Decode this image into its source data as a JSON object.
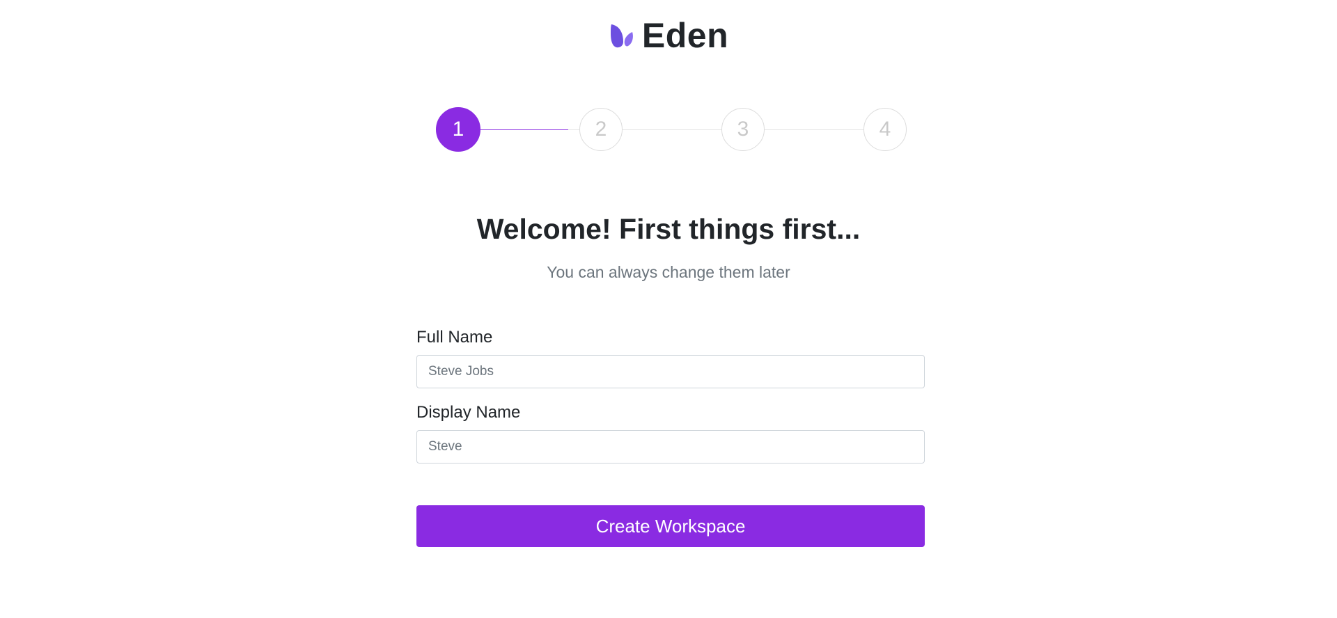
{
  "brand": {
    "name": "Eden",
    "logo_icon": "leaf-logo-icon",
    "logo_color": "#6c4fe0"
  },
  "stepper": {
    "steps": [
      "1",
      "2",
      "3",
      "4"
    ],
    "current_step": 1,
    "active_color": "#8a2be2"
  },
  "main": {
    "title": "Welcome! First things first...",
    "subtitle": "You can always change them later"
  },
  "form": {
    "full_name": {
      "label": "Full Name",
      "placeholder": "Steve Jobs",
      "value": ""
    },
    "display_name": {
      "label": "Display Name",
      "placeholder": "Steve",
      "value": ""
    },
    "submit_label": "Create Workspace"
  }
}
